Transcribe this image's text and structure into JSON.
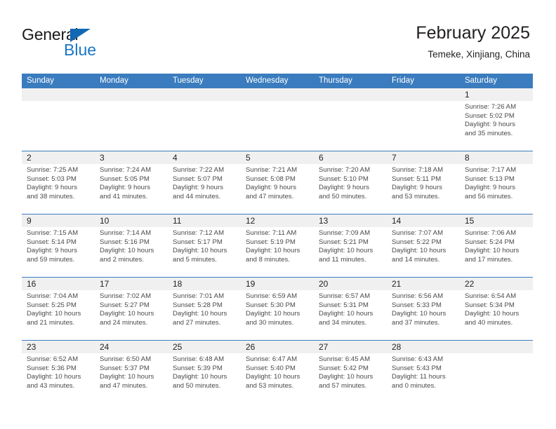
{
  "brand": {
    "name_top": "General",
    "name_bottom": "Blue",
    "accent_color": "#1877c5",
    "triangle_color": "#1268b3"
  },
  "header": {
    "title": "February 2025",
    "subtitle": "Temeke, Xinjiang, China"
  },
  "theme": {
    "header_blue": "#3a7cbe",
    "day_band_gray": "#f0f0f0",
    "text_color": "#231f20",
    "detail_text_color": "#4a4a4a"
  },
  "weekdays": [
    "Sunday",
    "Monday",
    "Tuesday",
    "Wednesday",
    "Thursday",
    "Friday",
    "Saturday"
  ],
  "weeks": [
    [
      {
        "day": "",
        "lines": []
      },
      {
        "day": "",
        "lines": []
      },
      {
        "day": "",
        "lines": []
      },
      {
        "day": "",
        "lines": []
      },
      {
        "day": "",
        "lines": []
      },
      {
        "day": "",
        "lines": []
      },
      {
        "day": "1",
        "lines": [
          "Sunrise: 7:26 AM",
          "Sunset: 5:02 PM",
          "Daylight: 9 hours",
          "and 35 minutes."
        ]
      }
    ],
    [
      {
        "day": "2",
        "lines": [
          "Sunrise: 7:25 AM",
          "Sunset: 5:03 PM",
          "Daylight: 9 hours",
          "and 38 minutes."
        ]
      },
      {
        "day": "3",
        "lines": [
          "Sunrise: 7:24 AM",
          "Sunset: 5:05 PM",
          "Daylight: 9 hours",
          "and 41 minutes."
        ]
      },
      {
        "day": "4",
        "lines": [
          "Sunrise: 7:22 AM",
          "Sunset: 5:07 PM",
          "Daylight: 9 hours",
          "and 44 minutes."
        ]
      },
      {
        "day": "5",
        "lines": [
          "Sunrise: 7:21 AM",
          "Sunset: 5:08 PM",
          "Daylight: 9 hours",
          "and 47 minutes."
        ]
      },
      {
        "day": "6",
        "lines": [
          "Sunrise: 7:20 AM",
          "Sunset: 5:10 PM",
          "Daylight: 9 hours",
          "and 50 minutes."
        ]
      },
      {
        "day": "7",
        "lines": [
          "Sunrise: 7:18 AM",
          "Sunset: 5:11 PM",
          "Daylight: 9 hours",
          "and 53 minutes."
        ]
      },
      {
        "day": "8",
        "lines": [
          "Sunrise: 7:17 AM",
          "Sunset: 5:13 PM",
          "Daylight: 9 hours",
          "and 56 minutes."
        ]
      }
    ],
    [
      {
        "day": "9",
        "lines": [
          "Sunrise: 7:15 AM",
          "Sunset: 5:14 PM",
          "Daylight: 9 hours",
          "and 59 minutes."
        ]
      },
      {
        "day": "10",
        "lines": [
          "Sunrise: 7:14 AM",
          "Sunset: 5:16 PM",
          "Daylight: 10 hours",
          "and 2 minutes."
        ]
      },
      {
        "day": "11",
        "lines": [
          "Sunrise: 7:12 AM",
          "Sunset: 5:17 PM",
          "Daylight: 10 hours",
          "and 5 minutes."
        ]
      },
      {
        "day": "12",
        "lines": [
          "Sunrise: 7:11 AM",
          "Sunset: 5:19 PM",
          "Daylight: 10 hours",
          "and 8 minutes."
        ]
      },
      {
        "day": "13",
        "lines": [
          "Sunrise: 7:09 AM",
          "Sunset: 5:21 PM",
          "Daylight: 10 hours",
          "and 11 minutes."
        ]
      },
      {
        "day": "14",
        "lines": [
          "Sunrise: 7:07 AM",
          "Sunset: 5:22 PM",
          "Daylight: 10 hours",
          "and 14 minutes."
        ]
      },
      {
        "day": "15",
        "lines": [
          "Sunrise: 7:06 AM",
          "Sunset: 5:24 PM",
          "Daylight: 10 hours",
          "and 17 minutes."
        ]
      }
    ],
    [
      {
        "day": "16",
        "lines": [
          "Sunrise: 7:04 AM",
          "Sunset: 5:25 PM",
          "Daylight: 10 hours",
          "and 21 minutes."
        ]
      },
      {
        "day": "17",
        "lines": [
          "Sunrise: 7:02 AM",
          "Sunset: 5:27 PM",
          "Daylight: 10 hours",
          "and 24 minutes."
        ]
      },
      {
        "day": "18",
        "lines": [
          "Sunrise: 7:01 AM",
          "Sunset: 5:28 PM",
          "Daylight: 10 hours",
          "and 27 minutes."
        ]
      },
      {
        "day": "19",
        "lines": [
          "Sunrise: 6:59 AM",
          "Sunset: 5:30 PM",
          "Daylight: 10 hours",
          "and 30 minutes."
        ]
      },
      {
        "day": "20",
        "lines": [
          "Sunrise: 6:57 AM",
          "Sunset: 5:31 PM",
          "Daylight: 10 hours",
          "and 34 minutes."
        ]
      },
      {
        "day": "21",
        "lines": [
          "Sunrise: 6:56 AM",
          "Sunset: 5:33 PM",
          "Daylight: 10 hours",
          "and 37 minutes."
        ]
      },
      {
        "day": "22",
        "lines": [
          "Sunrise: 6:54 AM",
          "Sunset: 5:34 PM",
          "Daylight: 10 hours",
          "and 40 minutes."
        ]
      }
    ],
    [
      {
        "day": "23",
        "lines": [
          "Sunrise: 6:52 AM",
          "Sunset: 5:36 PM",
          "Daylight: 10 hours",
          "and 43 minutes."
        ]
      },
      {
        "day": "24",
        "lines": [
          "Sunrise: 6:50 AM",
          "Sunset: 5:37 PM",
          "Daylight: 10 hours",
          "and 47 minutes."
        ]
      },
      {
        "day": "25",
        "lines": [
          "Sunrise: 6:48 AM",
          "Sunset: 5:39 PM",
          "Daylight: 10 hours",
          "and 50 minutes."
        ]
      },
      {
        "day": "26",
        "lines": [
          "Sunrise: 6:47 AM",
          "Sunset: 5:40 PM",
          "Daylight: 10 hours",
          "and 53 minutes."
        ]
      },
      {
        "day": "27",
        "lines": [
          "Sunrise: 6:45 AM",
          "Sunset: 5:42 PM",
          "Daylight: 10 hours",
          "and 57 minutes."
        ]
      },
      {
        "day": "28",
        "lines": [
          "Sunrise: 6:43 AM",
          "Sunset: 5:43 PM",
          "Daylight: 11 hours",
          "and 0 minutes."
        ]
      },
      {
        "day": "",
        "lines": []
      }
    ]
  ]
}
